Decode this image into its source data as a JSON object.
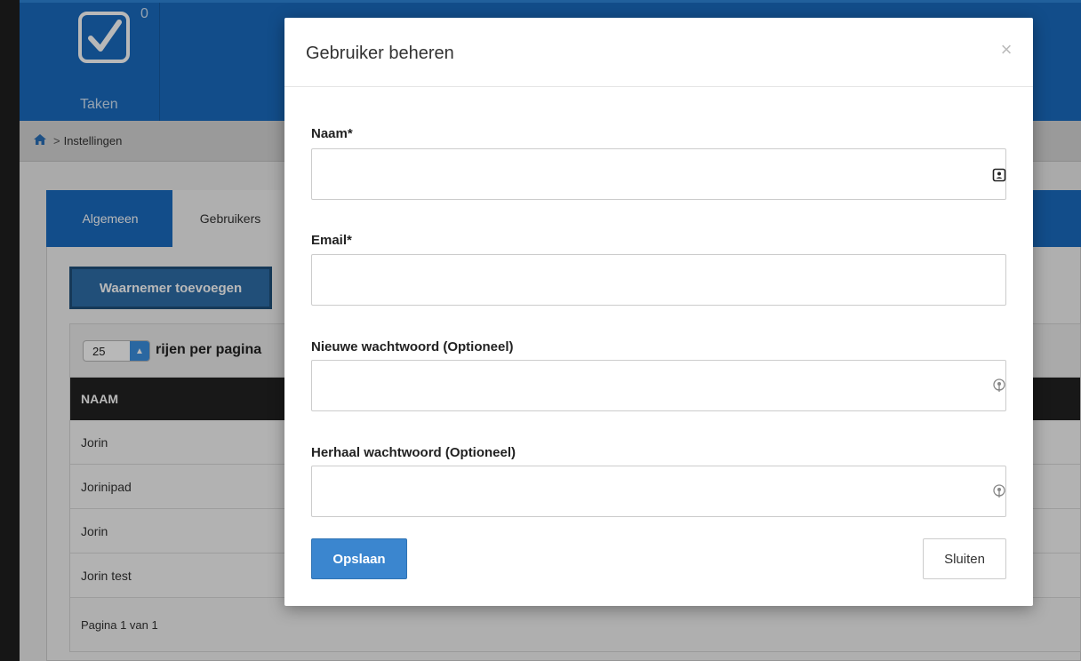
{
  "topbar": {
    "tasks_label": "Taken",
    "tasks_count": "0",
    "accent_color": "#1a6bbf"
  },
  "breadcrumb": {
    "home_icon": "home-icon",
    "separator": ">",
    "current": "Instellingen"
  },
  "tabs": [
    {
      "label": "Algemeen",
      "active": false
    },
    {
      "label": "Gebruikers",
      "active": true
    }
  ],
  "actions": {
    "add_substitute": "Waarnemer toevoegen"
  },
  "table": {
    "page_size": "25",
    "rows_per_page_label": "rijen per pagina",
    "columns": [
      "NAAM"
    ],
    "rows": [
      "Jorin",
      "Jorinipad",
      "Jorin",
      "Jorin test"
    ],
    "pagination": "Pagina 1 van 1"
  },
  "modal": {
    "title": "Gebruiker beheren",
    "close_symbol": "×",
    "fields": {
      "name": {
        "label": "Naam*",
        "value": "",
        "icon": "contact-card-icon"
      },
      "email": {
        "label": "Email*",
        "value": ""
      },
      "new_password": {
        "label": "Nieuwe wachtwoord (Optioneel)",
        "value": "",
        "icon": "password-key-icon"
      },
      "repeat_password": {
        "label": "Herhaal wachtwoord (Optioneel)",
        "value": "",
        "icon": "password-key-icon"
      }
    },
    "save_label": "Opslaan",
    "close_label": "Sluiten",
    "primary_color": "#3b86cf"
  }
}
